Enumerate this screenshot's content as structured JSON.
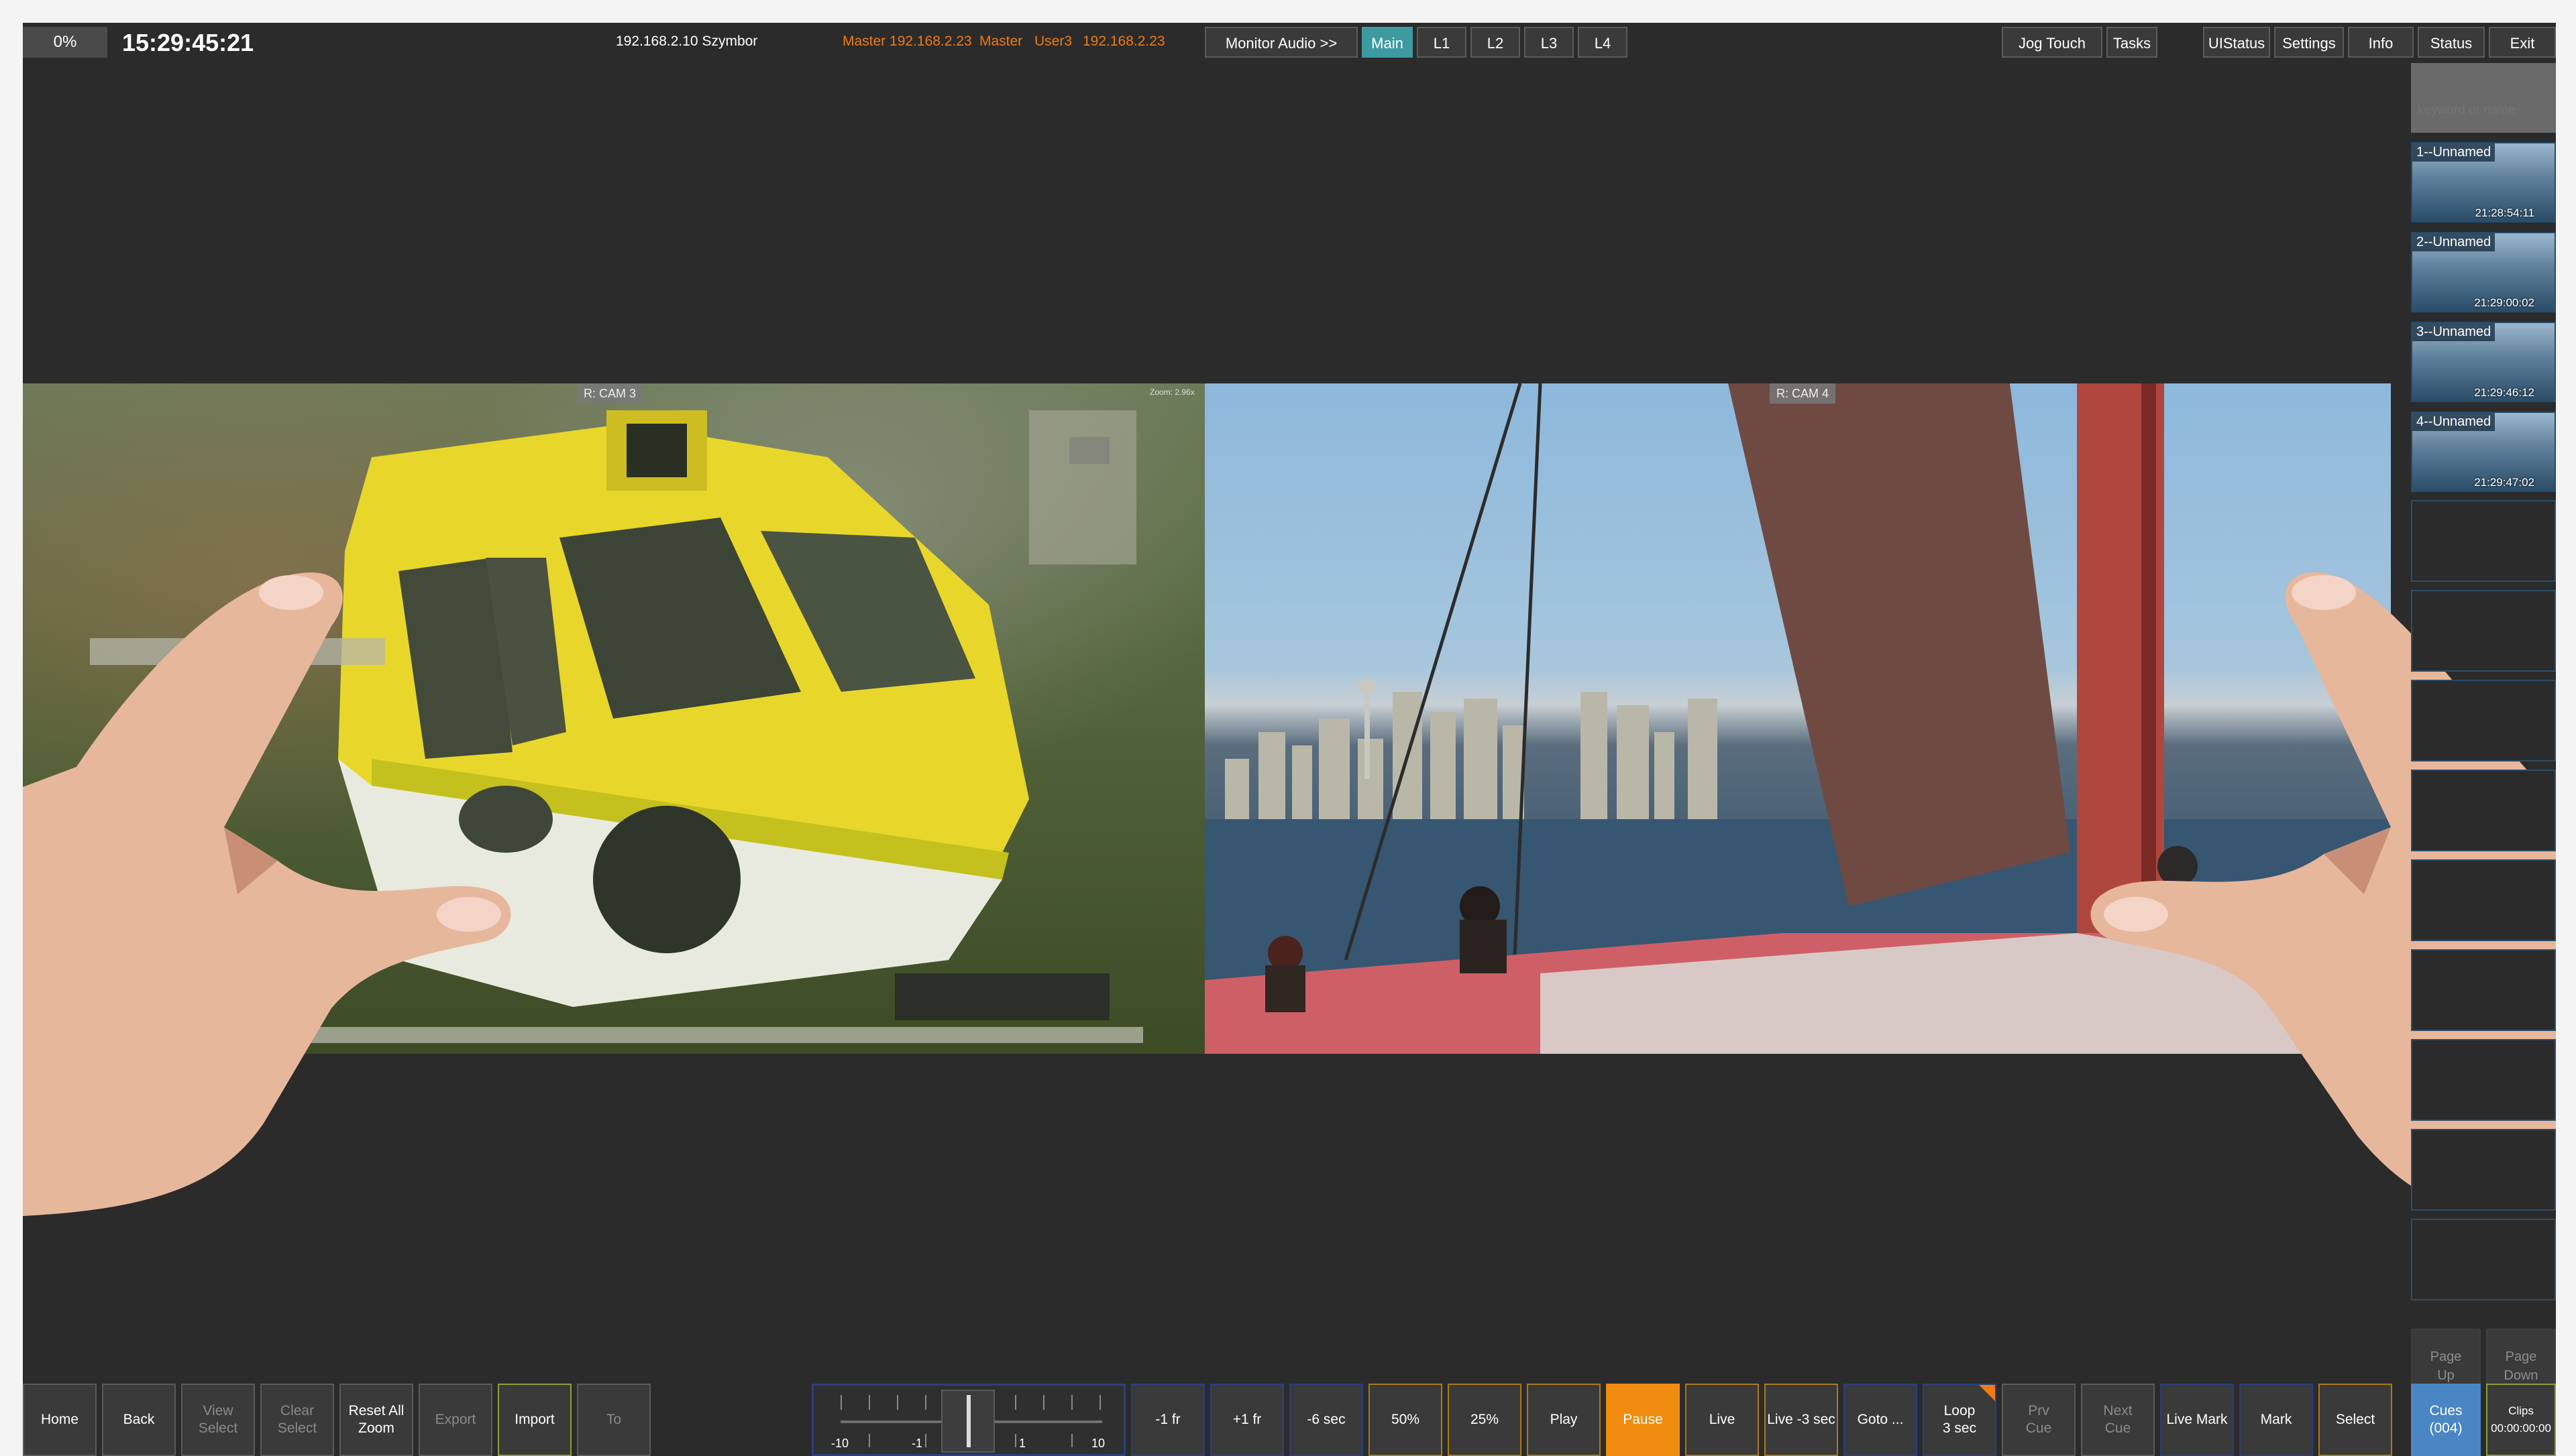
{
  "topbar": {
    "percent": "0%",
    "timecode": "15:29:45:21",
    "host": "192.168.2.10 Szymbor",
    "master_ip": "Master 192.168.2.23",
    "master_user": "Master",
    "user": "User3",
    "user_ip": "192.168.2.23",
    "buttons": {
      "monitor_audio": "Monitor Audio >>",
      "main": "Main",
      "l1": "L1",
      "l2": "L2",
      "l3": "L3",
      "l4": "L4",
      "jog_touch": "Jog Touch",
      "tasks": "Tasks",
      "uistatus": "UIStatus",
      "settings": "Settings",
      "info": "Info",
      "status": "Status",
      "exit": "Exit"
    }
  },
  "viewports": {
    "left_cam": "R: CAM 3",
    "left_zoom": "Zoom: 2.96x",
    "right_cam": "R: CAM 4"
  },
  "clips": {
    "search_placeholder": "keyword or name",
    "items": [
      {
        "label": "1--Unnamed",
        "timecode": "21:28:54:11"
      },
      {
        "label": "2--Unnamed",
        "timecode": "21:29:00:02"
      },
      {
        "label": "3--Unnamed",
        "timecode": "21:29:46:12"
      },
      {
        "label": "4--Unnamed",
        "timecode": "21:29:47:02"
      }
    ],
    "page_up": "Page\nUp",
    "page_down": "Page\nDown"
  },
  "bottombar": {
    "home": "Home",
    "back": "Back",
    "view_select": "View\nSelect",
    "clear_select": "Clear\nSelect",
    "reset_all_zoom": "Reset All\nZoom",
    "export": "Export",
    "import": "Import",
    "to": "To",
    "shuttle_labels": [
      "-10",
      "-1",
      "1",
      "10"
    ],
    "minus_1fr": "-1 fr",
    "plus_1fr": "+1 fr",
    "minus_6sec": "-6 sec",
    "pct50": "50%",
    "pct25": "25%",
    "play": "Play",
    "pause": "Pause",
    "live": "Live",
    "live_minus3": "Live -3 sec",
    "goto": "Goto ...",
    "loop": "Loop\n3 sec",
    "prv_cue": "Prv\nCue",
    "next_cue": "Next\nCue",
    "live_mark": "Live Mark",
    "mark": "Mark",
    "select": "Select",
    "cues": "Cues\n(004)",
    "clips": "Clips\n00:00:00:00"
  },
  "colors": {
    "background": "#2b2b2b",
    "accent_teal": "#3c9aa0",
    "accent_orange": "#f08c10",
    "accent_blue": "#4a86c4",
    "text_orange": "#f07b14"
  }
}
